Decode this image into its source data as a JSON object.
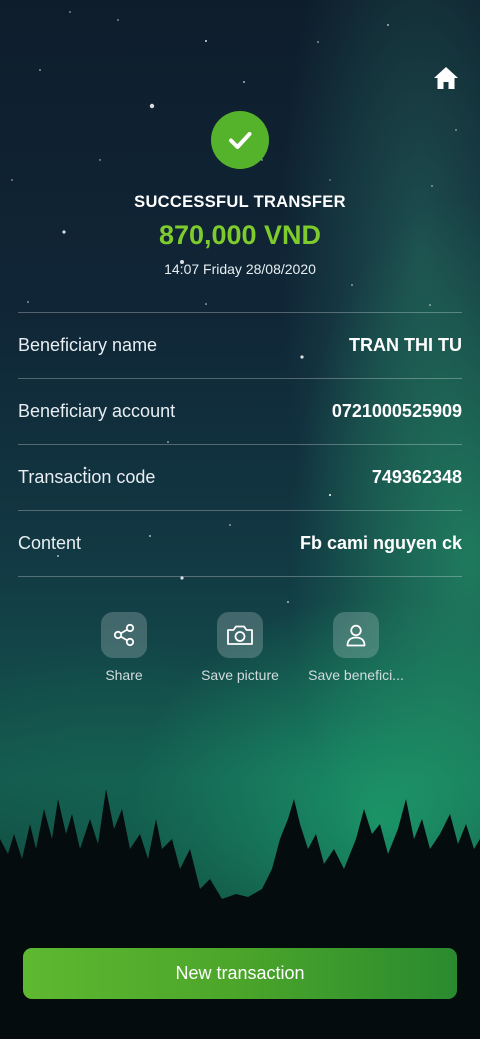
{
  "header": {
    "home_icon": "home-icon"
  },
  "status": {
    "icon": "check-icon",
    "icon_color": "#55b32b",
    "title": "SUCCESSFUL TRANSFER",
    "amount": "870,000 VND",
    "amount_color": "#7ecb2d",
    "datetime": "14:07 Friday 28/08/2020"
  },
  "details": [
    {
      "label": "Beneficiary name",
      "value": "TRAN THI TU"
    },
    {
      "label": "Beneficiary account",
      "value": "0721000525909"
    },
    {
      "label": "Transaction code",
      "value": "749362348"
    },
    {
      "label": "Content",
      "value": "Fb cami nguyen ck"
    }
  ],
  "actions": [
    {
      "label": "Share",
      "icon": "share-icon"
    },
    {
      "label": "Save picture",
      "icon": "camera-icon"
    },
    {
      "label": "Save benefici...",
      "icon": "person-icon"
    }
  ],
  "footer": {
    "new_transaction_label": "New transaction",
    "button_color": "#4ba52a"
  }
}
